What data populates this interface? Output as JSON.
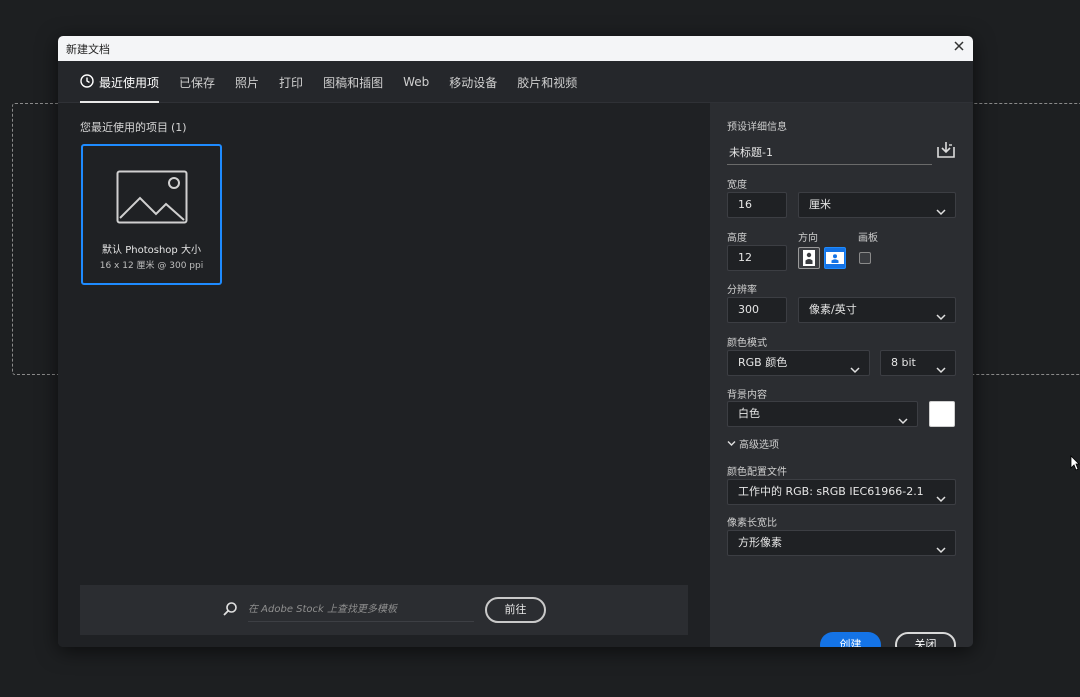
{
  "dialog": {
    "title": "新建文档"
  },
  "tabs": [
    {
      "label": "最近使用项",
      "active": true
    },
    {
      "label": "已保存"
    },
    {
      "label": "照片"
    },
    {
      "label": "打印"
    },
    {
      "label": "图稿和插图"
    },
    {
      "label": "Web"
    },
    {
      "label": "移动设备"
    },
    {
      "label": "胶片和视频"
    }
  ],
  "recent": {
    "title": "您最近使用的项目",
    "count": "(1)",
    "items": [
      {
        "name": "默认 Photoshop 大小",
        "details": "16 x 12 厘米 @ 300 ppi"
      }
    ]
  },
  "stock": {
    "placeholder": "在 Adobe Stock 上查找更多模板",
    "go_label": "前往"
  },
  "preset_details": {
    "section_title": "预设详细信息",
    "doc_name": "未标题-1",
    "width_label": "宽度",
    "width_value": "16",
    "width_unit": "厘米",
    "height_label": "高度",
    "height_value": "12",
    "orientation_label": "方向",
    "artboard_label": "画板",
    "resolution_label": "分辨率",
    "resolution_value": "300",
    "resolution_unit": "像素/英寸",
    "color_mode_label": "颜色模式",
    "color_mode_value": "RGB 颜色",
    "bit_depth_value": "8 bit",
    "background_label": "背景内容",
    "background_value": "白色",
    "background_color": "#ffffff",
    "advanced_label": "高级选项",
    "color_profile_label": "颜色配置文件",
    "color_profile_value": "工作中的 RGB: sRGB IEC61966-2.1",
    "pixel_aspect_label": "像素长宽比",
    "pixel_aspect_value": "方形像素"
  },
  "actions": {
    "create_label": "创建",
    "close_label": "关闭"
  },
  "colors": {
    "accent": "#1473e6",
    "selection": "#1e8bff"
  }
}
